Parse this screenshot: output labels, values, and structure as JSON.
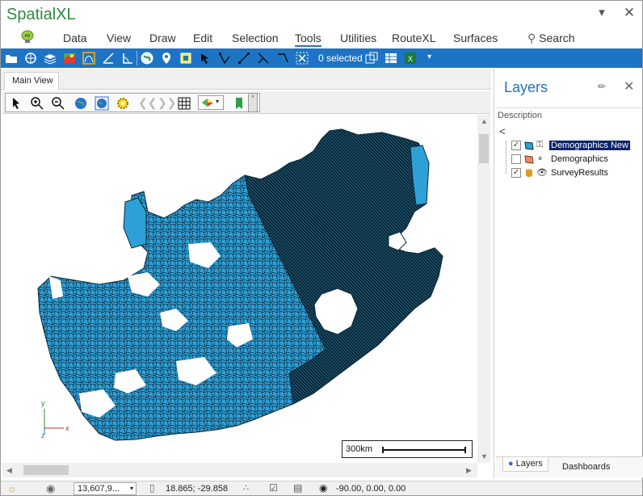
{
  "app": {
    "title": "SpatialXL"
  },
  "ribbon": {
    "tabs": [
      "Data",
      "View",
      "Draw",
      "Edit",
      "Selection",
      "Tools",
      "Utilities",
      "RouteXL",
      "Surfaces"
    ],
    "active_tab": "Tools",
    "search_label": "Search"
  },
  "toolbar": {
    "selection_count": "0 selected"
  },
  "document": {
    "tab_label": "Main View"
  },
  "map": {
    "scalebar_label": "300km",
    "axis_x": "x",
    "axis_y": "y",
    "axis_z": "z",
    "fill_color": "#2ea0d8",
    "dark_fill_color": "#0d2a3a"
  },
  "layers_panel": {
    "title": "Layers",
    "column_header": "Description",
    "back_glyph": "<",
    "layers": [
      {
        "label": "Demographics New",
        "checked": true,
        "selected": true
      },
      {
        "label": "Demographics",
        "checked": false,
        "selected": false
      },
      {
        "label": "SurveyResults",
        "checked": true,
        "selected": false
      }
    ],
    "bottom_tabs": [
      "Layers",
      "Dashboards"
    ]
  },
  "statusbar": {
    "scale_value": "13,607,9...",
    "coordinates": "18.865; -29.858",
    "view_angles": "-90.00, 0.00, 0.00"
  },
  "colors": {
    "accent": "#1e74c4",
    "brand_green": "#2e8b3e",
    "selection": "#0a246a"
  }
}
